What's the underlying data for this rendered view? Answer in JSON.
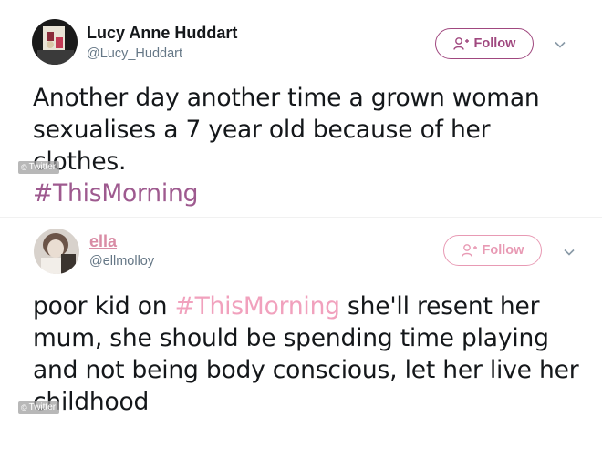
{
  "colors": {
    "hashtag_1": "#9e5a8f",
    "follow_1": "#a0487f",
    "hashtag_2": "#f1a1bd",
    "follow_2": "#e89ab4",
    "name_link_2": "#d98ca5",
    "handle": "#657786",
    "text": "#14171a"
  },
  "tweets": [
    {
      "display_name": "Lucy Anne Huddart",
      "handle": "@Lucy_Huddart",
      "follow_label": "Follow",
      "text_before": "Another day another time a grown woman sexualises a 7 year old because of her clothes.",
      "hashtag": "#ThisMorning",
      "text_after": "",
      "watermark": "Twitter",
      "watermark_symbol": "©",
      "icons": {
        "avatar": "user-avatar",
        "follow": "add-person-icon",
        "menu": "chevron-down-icon"
      }
    },
    {
      "display_name": "ella",
      "handle": "@ellmolloy",
      "follow_label": "Follow",
      "text_before": "poor kid on ",
      "hashtag": "#ThisMorning",
      "text_after": " she'll resent her mum, she should be spending time playing and not being body conscious, let her live her childhood",
      "watermark": "Twitter",
      "watermark_symbol": "©",
      "icons": {
        "avatar": "user-avatar",
        "follow": "add-person-icon",
        "menu": "chevron-down-icon"
      }
    }
  ]
}
